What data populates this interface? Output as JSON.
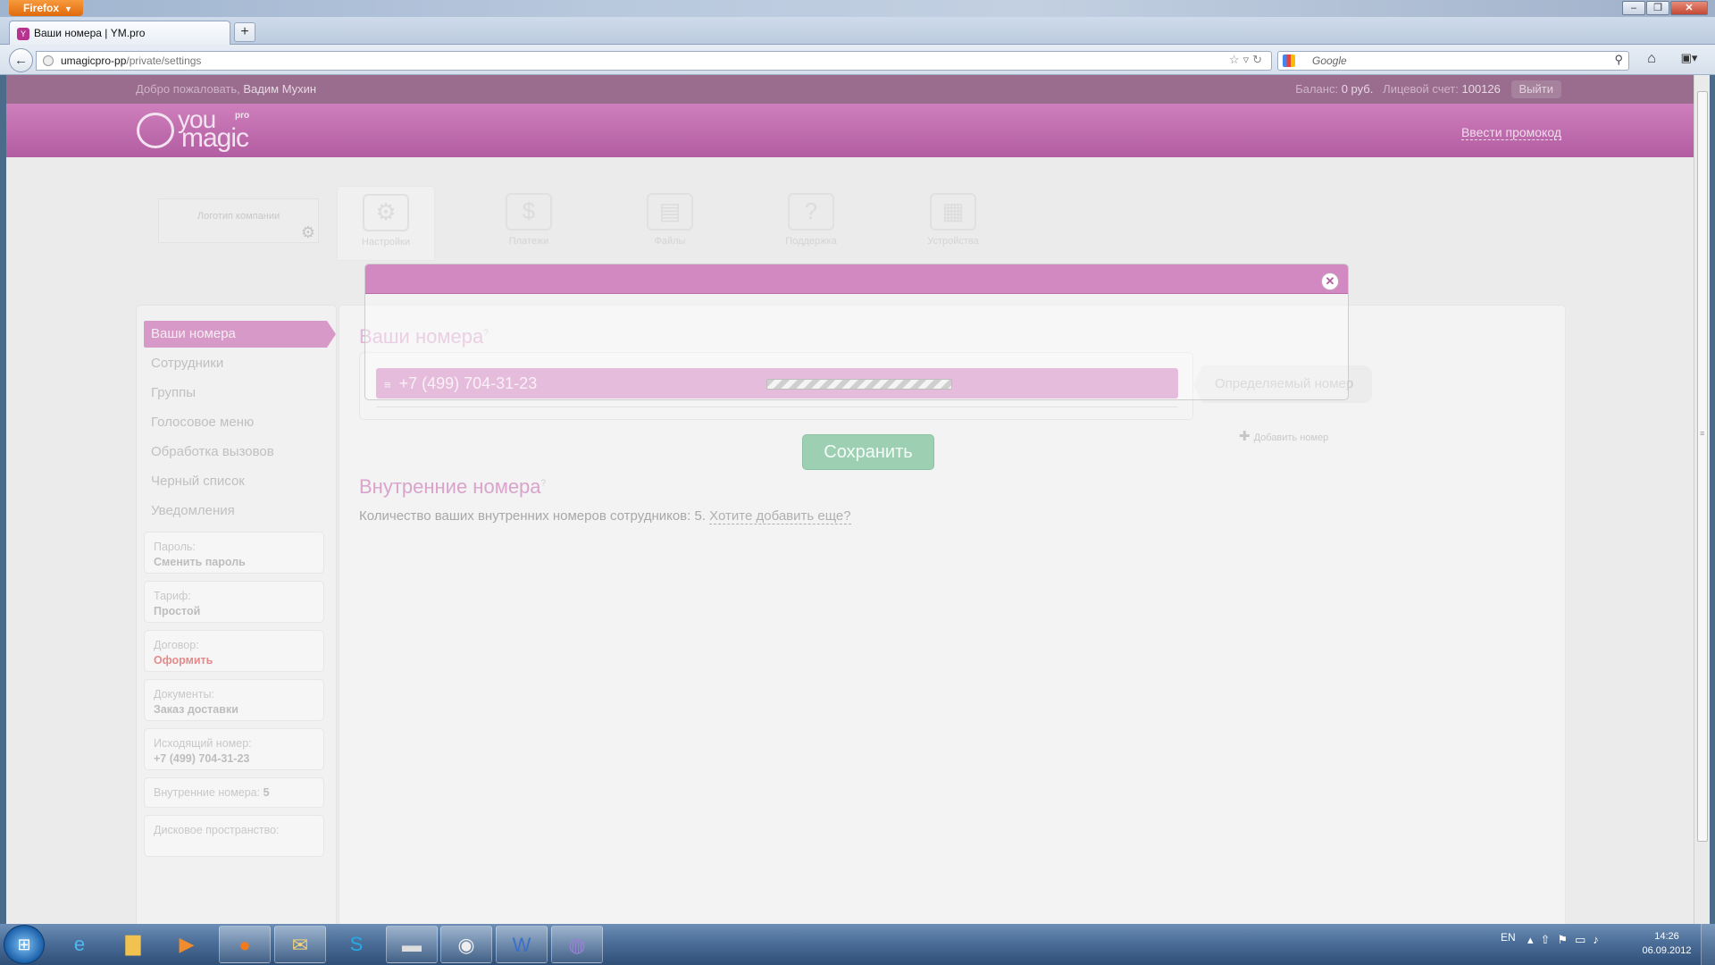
{
  "browser": {
    "app_button": "Firefox",
    "tab_title": "Ваши номера | YM.pro",
    "url_host": "umagicpro-pp",
    "url_path": "/private/settings",
    "search_placeholder": "Google"
  },
  "userbar": {
    "welcome": "Добро пожаловать,",
    "user_name": "Вадим Мухин",
    "balance_label": "Баланс:",
    "balance_value": "0 руб.",
    "account_label": "Лицевой счет:",
    "account_value": "100126",
    "logout": "Выйти"
  },
  "header": {
    "logo_you": "you",
    "logo_pro": "pro",
    "logo_magic": "magic",
    "promo_link": "Ввести промокод"
  },
  "company_logo": {
    "label": "Логотип компании"
  },
  "top_nav": [
    {
      "label": "Настройки",
      "icon": "settings-icon"
    },
    {
      "label": "Платежи",
      "icon": "payments-icon"
    },
    {
      "label": "Файлы",
      "icon": "files-icon"
    },
    {
      "label": "Поддержка",
      "icon": "support-icon"
    },
    {
      "label": "Устройства",
      "icon": "devices-icon"
    }
  ],
  "sidebar": {
    "items": [
      {
        "label": "Ваши номера",
        "active": true
      },
      {
        "label": "Сотрудники"
      },
      {
        "label": "Группы"
      },
      {
        "label": "Голосовое меню"
      },
      {
        "label": "Обработка вызовов"
      },
      {
        "label": "Черный список"
      },
      {
        "label": "Уведомления"
      }
    ],
    "info": {
      "password_label": "Пароль:",
      "password_value": "Сменить пароль",
      "tariff_label": "Тариф:",
      "tariff_value": "Простой",
      "contract_label": "Договор:",
      "contract_value": "Оформить",
      "documents_label": "Документы:",
      "documents_value": "Заказ доставки",
      "outgoing_label": "Исходящий номер:",
      "outgoing_value": "+7 (499) 704-31-23",
      "internal_label": "Внутренние номера:",
      "internal_value": "5",
      "disk_label": "Дисковое пространство:"
    }
  },
  "main": {
    "numbers_title": "Ваши номера",
    "numbers": [
      "+7 (499) 704-31-23"
    ],
    "caller_id_label": "Определяемый номер",
    "add_number": "Добавить номер",
    "save_button": "Сохранить",
    "internal_title": "Внутренние номера",
    "internal_text": "Количество ваших внутренних номеров сотрудников: 5.",
    "internal_link": "Хотите добавить еще?"
  },
  "taskbar": {
    "language": "EN",
    "time": "14:26",
    "date": "06.09.2012"
  }
}
